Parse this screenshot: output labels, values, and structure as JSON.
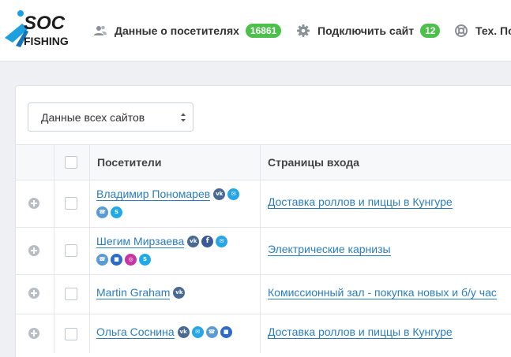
{
  "header": {
    "logo_text_top": "SOC",
    "logo_text_bottom": "FISHING",
    "nav": [
      {
        "label": "Данные о посетителях",
        "badge": "16861",
        "icon": "users-icon"
      },
      {
        "label": "Подключить сайт",
        "badge": "12",
        "icon": "gear-icon"
      },
      {
        "label": "Тех. По",
        "icon": "lifebuoy-icon"
      }
    ]
  },
  "filter": {
    "selected": "Данные всех сайтов"
  },
  "table": {
    "columns": [
      "",
      "",
      "Посетители",
      "Страницы входа"
    ],
    "rows": [
      {
        "name": "Владимир Пономарев",
        "icons_inline": [
          "vk-icon",
          "mail-icon"
        ],
        "icons_below": [
          "phone-icon",
          "skype-icon"
        ],
        "page": "Доставка роллов и пиццы в Кунгуре"
      },
      {
        "name": "Шегим Мирзаева",
        "icons_inline": [
          "vk-icon",
          "facebook-icon",
          "mail-icon"
        ],
        "icons_below": [
          "phone-icon",
          "chat-icon",
          "instagram-icon",
          "skype-icon"
        ],
        "page": "Электрические карнизы"
      },
      {
        "name": "Martin Graham",
        "icons_inline": [
          "vk-icon"
        ],
        "icons_below": [],
        "page": "Комиссионный зал - покупка новых и б/у час"
      },
      {
        "name": "Ольга Соснина",
        "icons_inline": [
          "vk-icon",
          "mail-icon",
          "phone-icon",
          "chat-icon"
        ],
        "icons_below": [],
        "page": "Доставка роллов и пиццы в Кунгуре"
      }
    ]
  },
  "colors": {
    "accent": "#2a7dbf",
    "badge": "#4cc04a",
    "logo_blue": "#1e9fe0"
  }
}
